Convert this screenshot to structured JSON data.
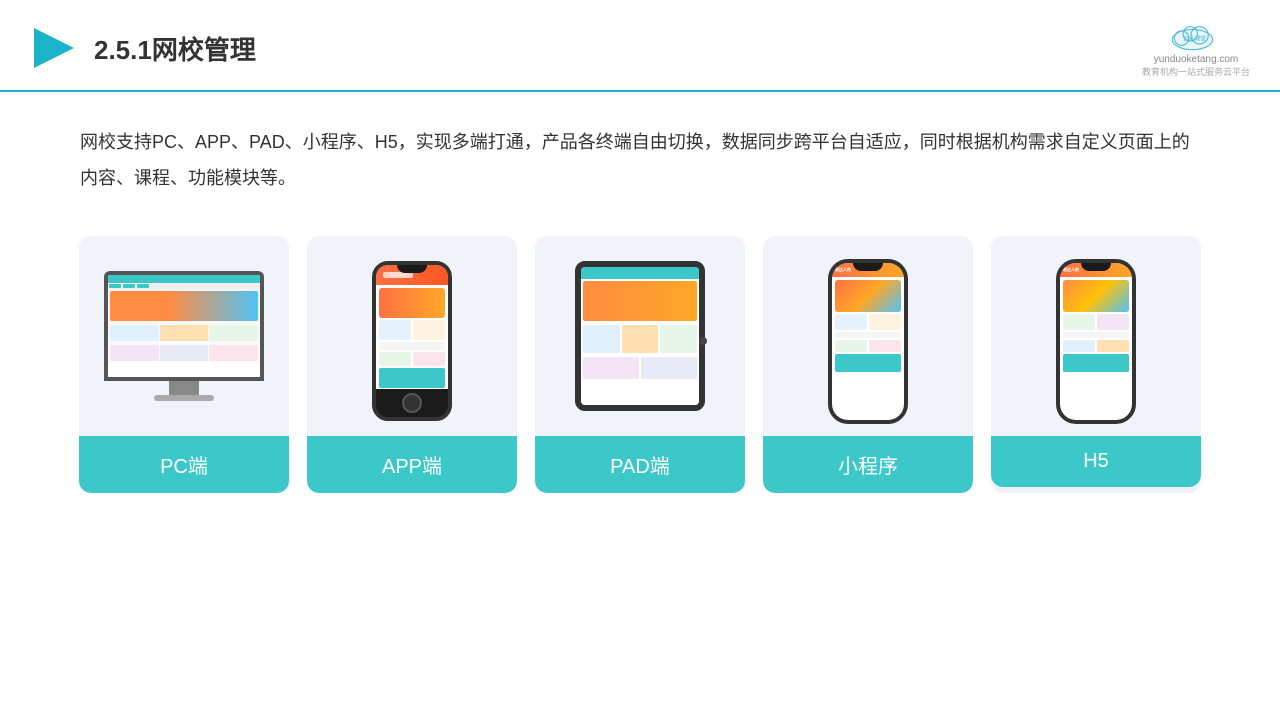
{
  "header": {
    "title": "2.5.1网校管理",
    "logo_name": "云朵课堂",
    "logo_domain": "yunduoketang.com",
    "logo_tagline": "教育机构一站",
    "logo_tagline2": "式服务云平台"
  },
  "description": {
    "text": "网校支持PC、APP、PAD、小程序、H5，实现多端打通，产品各终端自由切换，数据同步跨平台自适应，同时根据机构需求自定义页面上的内容、课程、功能模块等。"
  },
  "cards": [
    {
      "id": "pc",
      "label": "PC端"
    },
    {
      "id": "app",
      "label": "APP端"
    },
    {
      "id": "pad",
      "label": "PAD端"
    },
    {
      "id": "miniprogram",
      "label": "小程序"
    },
    {
      "id": "h5",
      "label": "H5"
    }
  ],
  "accent_color": "#3cc8c8"
}
